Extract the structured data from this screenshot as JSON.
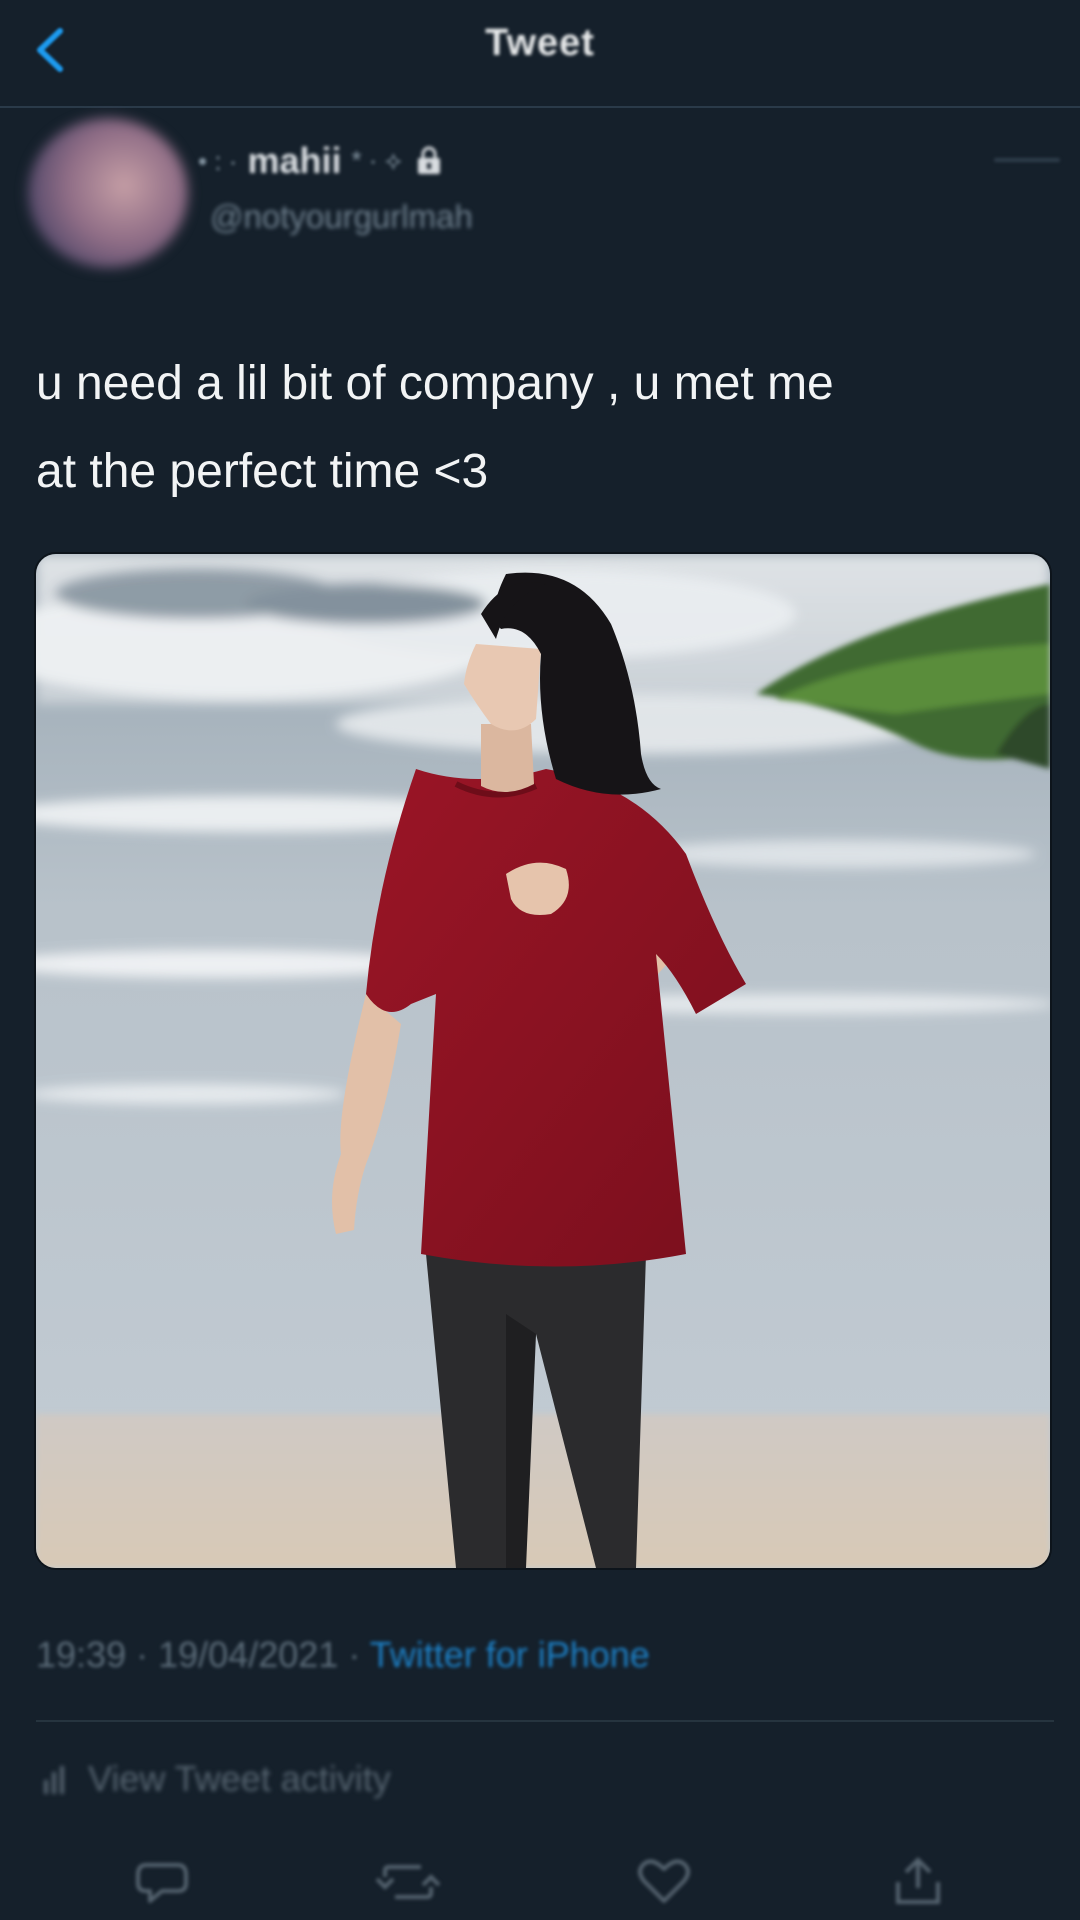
{
  "nav": {
    "title": "Tweet",
    "back_icon": "chevron-left-icon"
  },
  "author": {
    "name_prefix": "• : ·",
    "name": "mahii",
    "name_suffix": "* · ⟡",
    "handle": "@notyourgurlmah",
    "protected": true
  },
  "tweet": {
    "text_line_1": "u need a lil bit of company , u met me",
    "text_line_2": "at the perfect time <3",
    "time": "19:39",
    "date": "19/04/2021",
    "separator": "·",
    "source": "Twitter for iPhone"
  },
  "activity": {
    "label": "View Tweet activity"
  },
  "actions": {
    "reply_icon": "reply-icon",
    "retweet_icon": "retweet-icon",
    "like_icon": "heart-icon",
    "share_icon": "share-icon"
  },
  "colors": {
    "background": "#15202b",
    "accent": "#1d9bf0",
    "muted_text": "#5b6b78"
  }
}
